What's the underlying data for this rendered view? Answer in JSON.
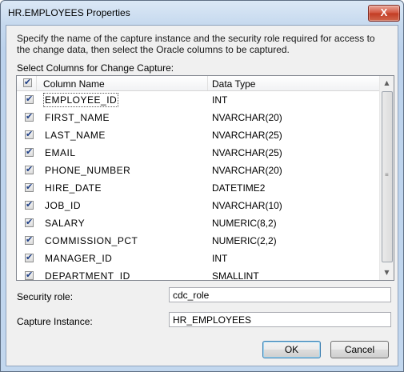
{
  "window": {
    "title": "HR.EMPLOYEES Properties",
    "close_symbol": "X"
  },
  "description": "Specify the name of the capture instance and the security role required for access to the change data, then select the Oracle columns to be captured.",
  "select_label": "Select Columns for Change Capture:",
  "table": {
    "headers": {
      "name": "Column Name",
      "type": "Data Type"
    },
    "rows": [
      {
        "name": "EMPLOYEE_ID",
        "type": "INT",
        "checked": true
      },
      {
        "name": "FIRST_NAME",
        "type": "NVARCHAR(20)",
        "checked": true
      },
      {
        "name": "LAST_NAME",
        "type": "NVARCHAR(25)",
        "checked": true
      },
      {
        "name": "EMAIL",
        "type": "NVARCHAR(25)",
        "checked": true
      },
      {
        "name": "PHONE_NUMBER",
        "type": "NVARCHAR(20)",
        "checked": true
      },
      {
        "name": "HIRE_DATE",
        "type": "DATETIME2",
        "checked": true
      },
      {
        "name": "JOB_ID",
        "type": "NVARCHAR(10)",
        "checked": true
      },
      {
        "name": "SALARY",
        "type": "NUMERIC(8,2)",
        "checked": true
      },
      {
        "name": "COMMISSION_PCT",
        "type": "NUMERIC(2,2)",
        "checked": true
      },
      {
        "name": "MANAGER_ID",
        "type": "INT",
        "checked": true
      },
      {
        "name": "DEPARTMENT_ID",
        "type": "SMALLINT",
        "checked": true
      }
    ]
  },
  "security_role": {
    "label": "Security role:",
    "value": "cdc_role"
  },
  "capture_instance": {
    "label": "Capture Instance:",
    "value": "HR_EMPLOYEES"
  },
  "buttons": {
    "ok": "OK",
    "cancel": "Cancel"
  }
}
